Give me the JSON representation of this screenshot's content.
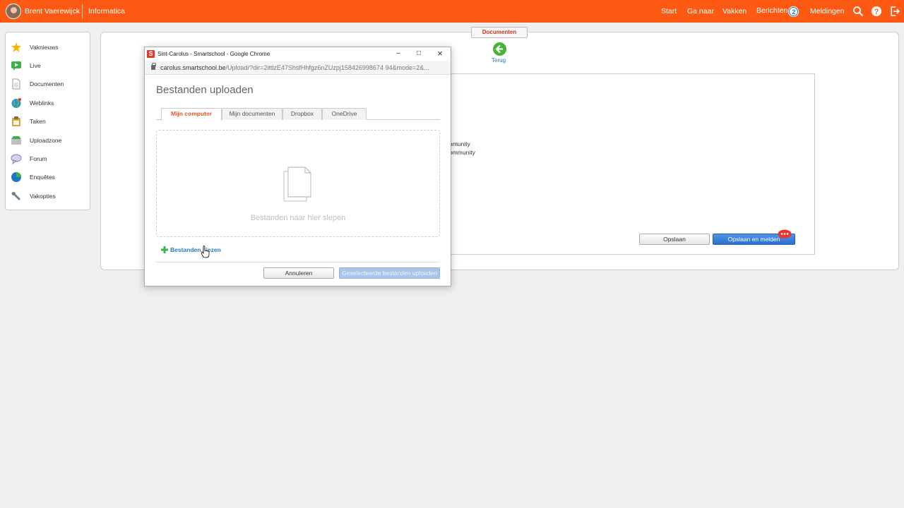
{
  "topbar": {
    "user_name": "Brent Vaerewijck",
    "course_name": "Informatica",
    "nav": [
      "Start",
      "Ga naar",
      "Vakken",
      "Berichten",
      "Meldingen"
    ],
    "messages_count": "2",
    "icons": [
      "search-icon",
      "help-icon",
      "logout-icon"
    ],
    "bar_color": "#ff5a14"
  },
  "sidebar": {
    "items": [
      {
        "label": "Vaknieuws",
        "icon": "star-icon"
      },
      {
        "label": "Live",
        "icon": "live-video-icon"
      },
      {
        "label": "Documenten",
        "icon": "document-icon"
      },
      {
        "label": "Weblinks",
        "icon": "globe-icon"
      },
      {
        "label": "Taken",
        "icon": "tasks-icon"
      },
      {
        "label": "Uploadzone",
        "icon": "upload-icon"
      },
      {
        "label": "Forum",
        "icon": "forum-icon"
      },
      {
        "label": "Enquêtes",
        "icon": "pie-chart-icon"
      },
      {
        "label": "Vakopties",
        "icon": "wrench-icon"
      }
    ]
  },
  "main": {
    "documents_tab": "Documenten",
    "back_label": "Terug",
    "partial_lines": [
      "nmunity",
      "ommunity"
    ],
    "save_label": "Opslaan",
    "save_notify_label": "Opslaan en melden"
  },
  "popup": {
    "window_title": "Sint-Carolus - Smartschool - Google Chrome",
    "url_host": "carolus.smartschool.be",
    "url_rest": "/Upload/?dir=2ittlzE47ShsfHhfgz6nZUzpj158426998674 94&mode=2&...",
    "heading": "Bestanden uploaden",
    "tabs": [
      "Mijn computer",
      "Mijn documenten",
      "Dropbox",
      "OneDrive"
    ],
    "drop_text": "Bestanden naar hier slepen",
    "choose_files": "Bestanden kiezen",
    "cancel_label": "Annuleren",
    "upload_label": "Geselecteerde bestanden uploaden"
  }
}
